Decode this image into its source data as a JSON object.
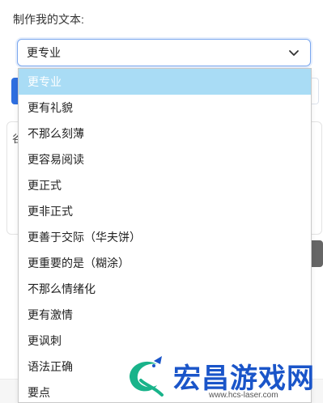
{
  "form": {
    "label": "制作我的文本:",
    "selected_value": "更专业"
  },
  "background": {
    "area_glyph": "谷"
  },
  "dropdown": {
    "options": [
      "更专业",
      "更有礼貌",
      "不那么刻薄",
      "更容易阅读",
      "更正式",
      "更非正式",
      "更善于交际（华夫饼）",
      "更重要的是（糊涂）",
      "不那么情绪化",
      "更有激情",
      "更讽刺",
      "语法正确",
      "要点"
    ],
    "selected_index": 0
  },
  "watermark": {
    "title": "宏昌游戏网",
    "url": "www.hcs-laser.com"
  },
  "colors": {
    "accent": "#7aa7ee",
    "selected_bg": "#a9dcf5",
    "primary_button": "#2f6fe0",
    "watermark_blue": "#1a55c9",
    "watermark_green": "#19b38a"
  }
}
